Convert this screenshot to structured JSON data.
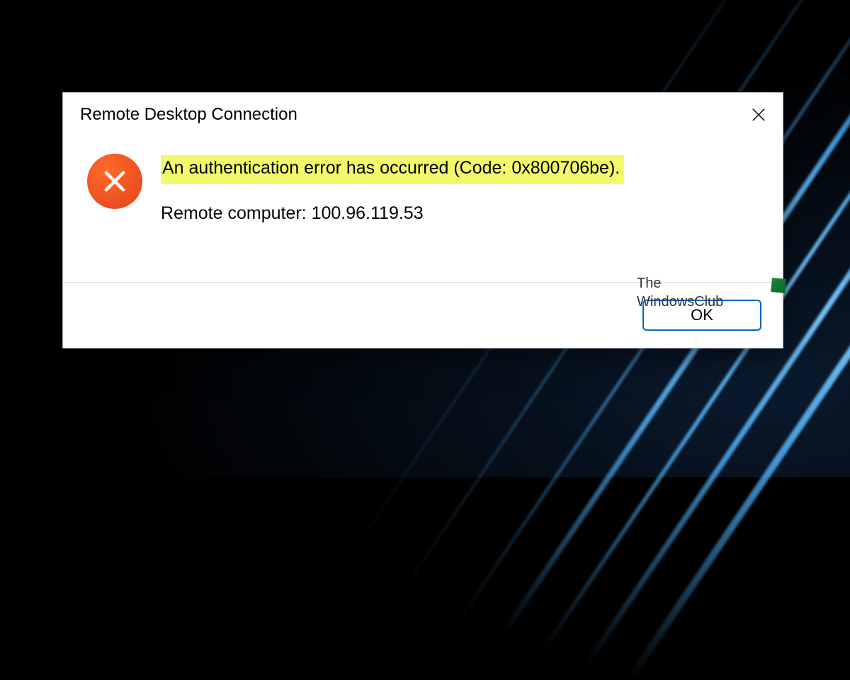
{
  "dialog": {
    "title": "Remote Desktop Connection",
    "error_message": "An authentication error has occurred (Code: 0x800706be).",
    "remote_computer_line": "Remote computer: 100.96.119.53",
    "ok_label": "OK"
  },
  "watermark": {
    "line1": "The",
    "line2": "WindowsClub"
  }
}
